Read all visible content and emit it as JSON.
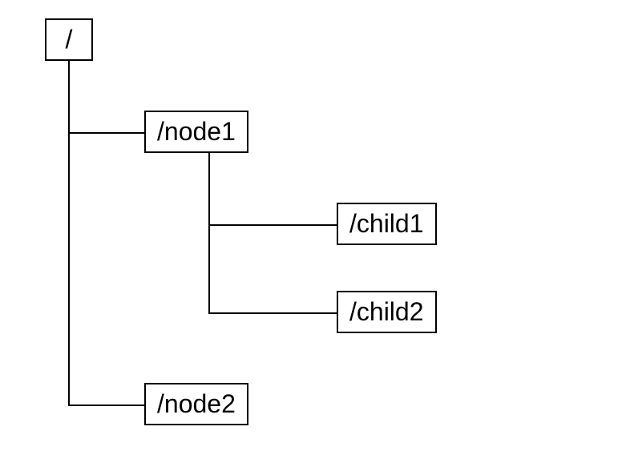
{
  "tree": {
    "root": {
      "label": "/",
      "children": [
        {
          "key": "node1",
          "label": "/node1",
          "children": [
            {
              "key": "child1",
              "label": "/child1"
            },
            {
              "key": "child2",
              "label": "/child2"
            }
          ]
        },
        {
          "key": "node2",
          "label": "/node2"
        }
      ]
    }
  }
}
